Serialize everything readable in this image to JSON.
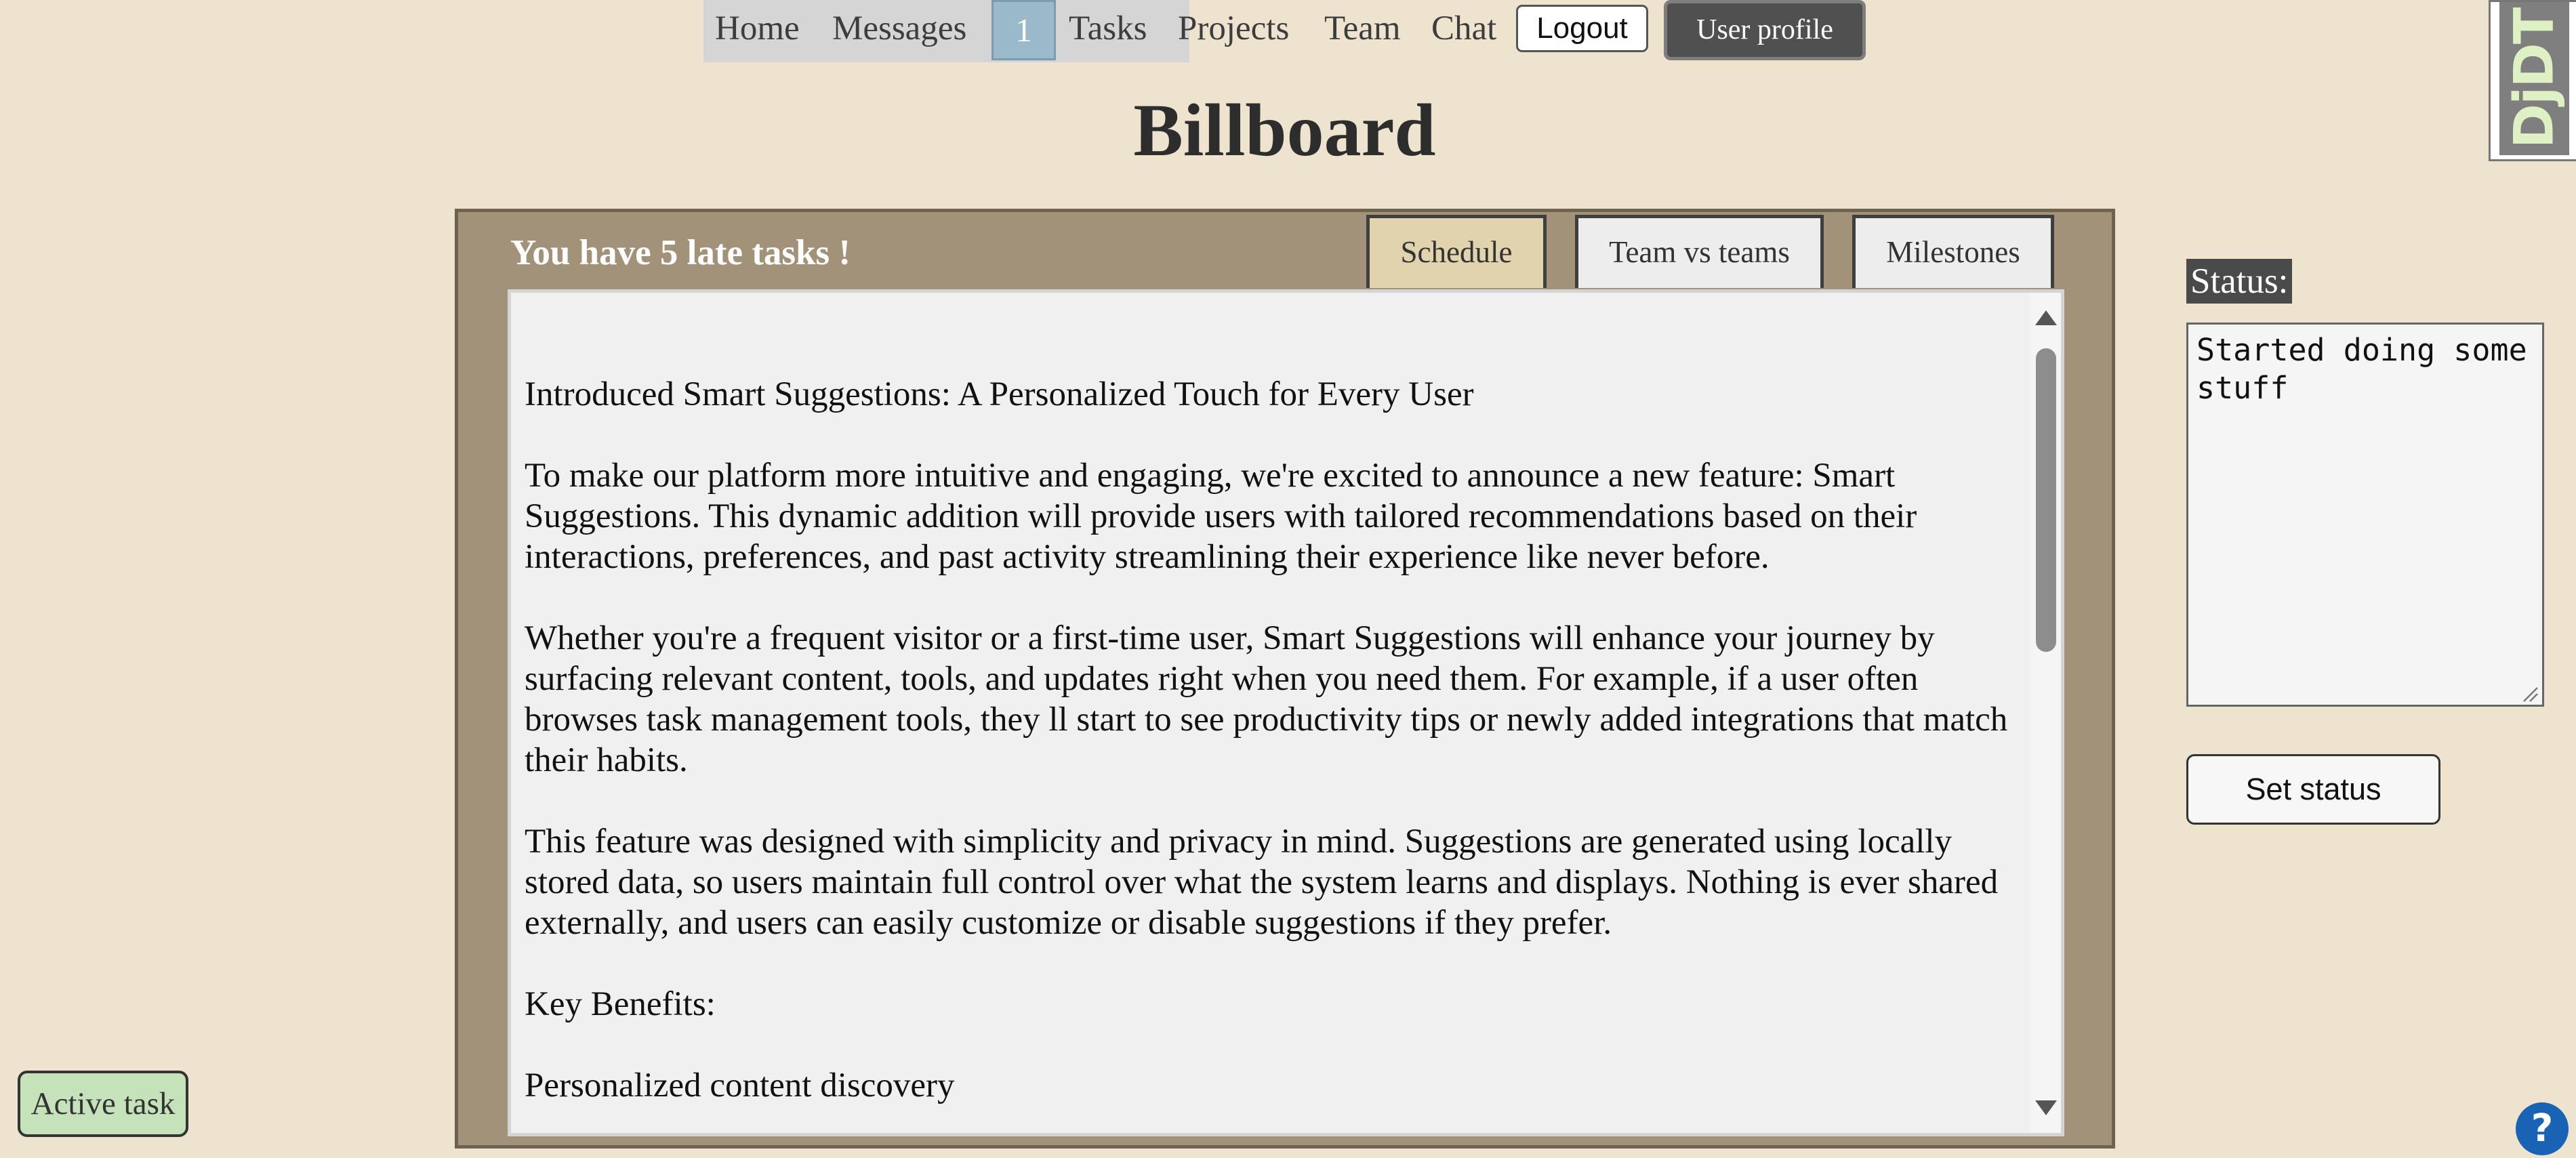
{
  "nav": {
    "items": [
      {
        "label": "Home"
      },
      {
        "label": "Messages"
      },
      {
        "label": "Tasks"
      },
      {
        "label": "Projects"
      },
      {
        "label": "Team"
      },
      {
        "label": "Chat"
      }
    ],
    "message_count": "1",
    "logout_label": "Logout",
    "profile_label": "User profile"
  },
  "debug_toolbar": {
    "label": "DjDT"
  },
  "page": {
    "title": "Billboard"
  },
  "billboard": {
    "late_tasks_text": "You have 5 late tasks !",
    "tabs": [
      {
        "label": "Schedule",
        "active": true
      },
      {
        "label": "Team vs teams",
        "active": false
      },
      {
        "label": "Milestones",
        "active": false
      }
    ],
    "content": {
      "paragraphs": [
        "Introduced Smart Suggestions: A Personalized Touch for Every User",
        "To make our platform more intuitive and engaging, we're excited to announce a new feature: Smart Suggestions. This dynamic addition will provide users with tailored recommendations based on their interactions, preferences, and past activity streamlining their experience like never before.",
        "Whether you're a frequent visitor or a first-time user, Smart Suggestions will enhance your journey by surfacing relevant content, tools, and updates right when you need them. For example, if a user often browses task management tools, they ll start to see productivity tips or newly added integrations that match their habits.",
        "This feature was designed with simplicity and privacy in mind. Suggestions are generated using locally stored data, so users maintain full control over what the system learns and displays. Nothing is ever shared externally, and users can easily customize or disable suggestions if they prefer.",
        "Key Benefits:",
        "Personalized content discovery"
      ]
    }
  },
  "status": {
    "label": "Status:",
    "value": "Started doing some stuff",
    "button_label": "Set status"
  },
  "active_task": {
    "label": "Active task"
  },
  "help": {
    "label": "?"
  },
  "colors": {
    "background": "#ede3cf",
    "billboard_frame": "#a2927a",
    "active_tab": "#e0d3ad",
    "message_badge": "#9ab9cb",
    "active_task": "#c6e2bb",
    "help": "#1a62b3"
  }
}
